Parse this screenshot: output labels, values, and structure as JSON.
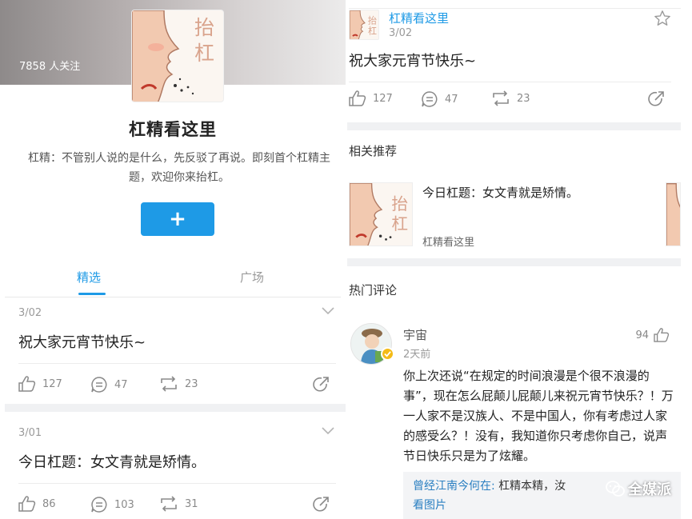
{
  "left": {
    "followers": "7858 人关注",
    "title": "杠精看这里",
    "description": "杠精：不管别人说的是什么，先反驳了再说。即刻首个杠精主题，欢迎你来抬杠。",
    "plus_label": "+",
    "avatar_text": "抬杠",
    "tabs": [
      {
        "label": "精选",
        "active": true
      },
      {
        "label": "广场",
        "active": false
      }
    ],
    "posts": [
      {
        "date": "3/02",
        "text": "祝大家元宵节快乐~",
        "likes": "127",
        "comments": "47",
        "reposts": "23"
      },
      {
        "date": "3/01",
        "text": "今日杠题：女文青就是矫情。",
        "likes": "86",
        "comments": "103",
        "reposts": "31"
      }
    ]
  },
  "right": {
    "post": {
      "author": "杠精看这里",
      "date": "3/02",
      "text": "祝大家元宵节快乐~",
      "likes": "127",
      "comments": "47",
      "reposts": "23"
    },
    "related_title": "相关推荐",
    "related": {
      "title": "今日杠题：女文青就是矫情。",
      "author": "杠精看这里"
    },
    "hot_comments_title": "热门评论",
    "comment": {
      "name": "宇宙",
      "time": "2天前",
      "likes": "94",
      "text": "你上次还说“在规定的时间浪漫是个很不浪漫的事”，现在怎么屁颠儿屁颠儿来祝元宵节快乐？！万一人家不是汉族人、不是中国人，你有考虑过人家的感受么？！没有，我知道你只考虑你自己，说声节日快乐只是为了炫耀。",
      "reply_name": "曾经江南今何在:",
      "reply_text": " 杠精本精，汝",
      "reply_link": "看图片"
    },
    "watermark": "全媒派"
  },
  "colors": {
    "accent": "#1e9ae6",
    "link": "#2a7fc1",
    "badge": "#f4bb17"
  }
}
